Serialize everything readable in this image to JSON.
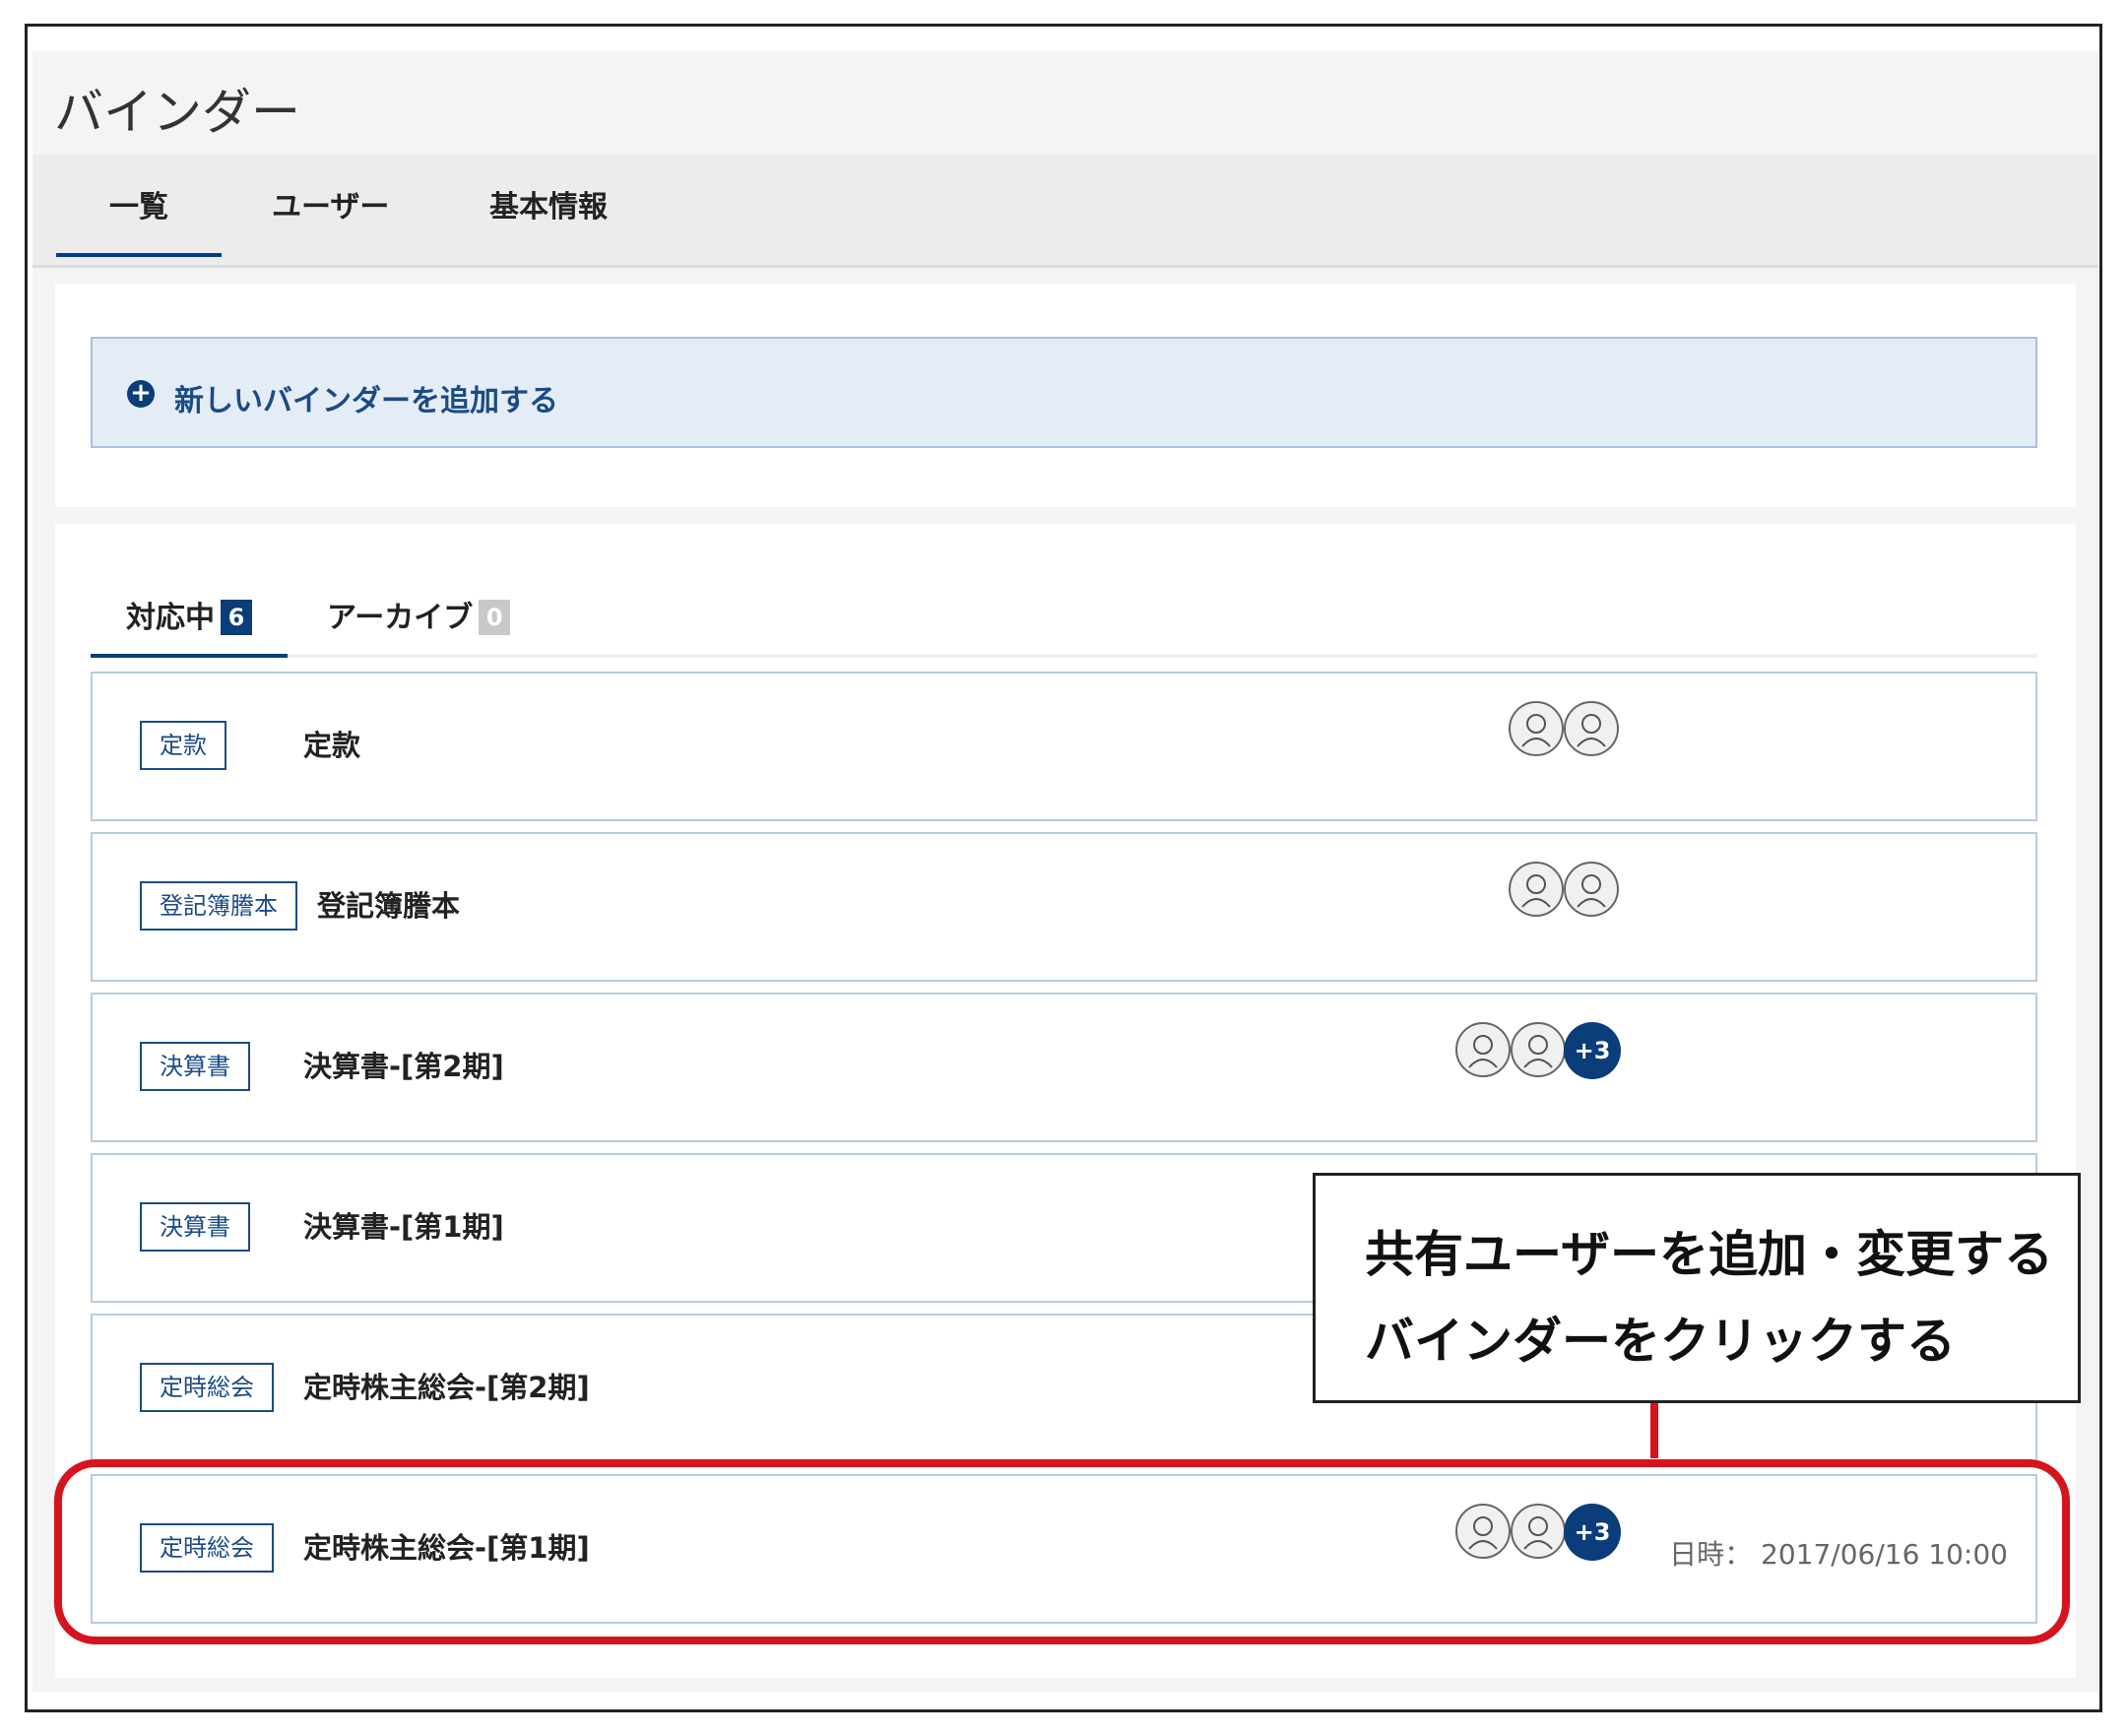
{
  "header": {
    "title": "バインダー"
  },
  "tabs": [
    {
      "label": "一覧"
    },
    {
      "label": "ユーザー"
    },
    {
      "label": "基本情報"
    }
  ],
  "add_binder": {
    "label": "新しいバインダーを追加する"
  },
  "subtabs": [
    {
      "label": "対応中",
      "count": "6",
      "badge_color": "#0a3d7a"
    },
    {
      "label": "アーカイブ",
      "count": "0",
      "badge_color": "#c8c8c8"
    }
  ],
  "rows": [
    {
      "tag": "定款",
      "title": "定款",
      "more": "",
      "datetime": ""
    },
    {
      "tag": "登記簿謄本",
      "title": "登記簿謄本",
      "more": "",
      "datetime": ""
    },
    {
      "tag": "決算書",
      "title": "決算書-[第2期]",
      "more": "+3",
      "datetime": ""
    },
    {
      "tag": "決算書",
      "title": "決算書-[第1期]",
      "more": "",
      "datetime": ""
    },
    {
      "tag": "定時総会",
      "title": "定時株主総会-[第2期]",
      "more": "",
      "datetime": ""
    },
    {
      "tag": "定時総会",
      "title": "定時株主総会-[第1期]",
      "more": "+3",
      "datetime": "日時： 2017/06/16 10:00"
    }
  ],
  "callout": {
    "line1": "共有ユーザーを追加・変更する",
    "line2": "バインダーをクリックする"
  },
  "colors": {
    "accent": "#0a3d7a",
    "highlight": "#d5141d"
  }
}
